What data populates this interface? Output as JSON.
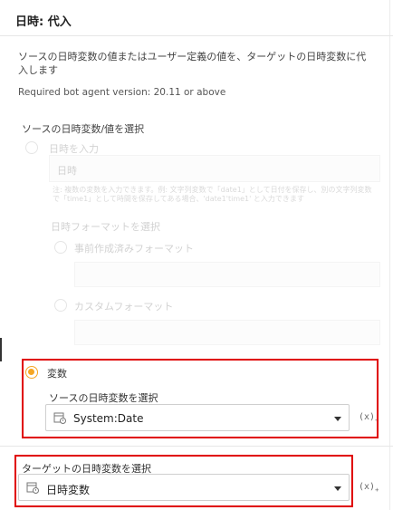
{
  "header": {
    "title": "日時: 代入"
  },
  "description": "ソースの日時変数の値またはユーザー定義の値を、ターゲットの日時変数に代入します",
  "version_text": "Required bot agent version: 20.11 or above",
  "source": {
    "label": "ソースの日時変数/値を選択",
    "option_enter": {
      "label": "日時を入力",
      "placeholder": "日時",
      "hint": "注: 複数の変数を入力できます。例: 文字列変数で「date1」として日付を保存し、別の文字列変数で「time1」として時間を保存してある場合、'date1'time1' と入力できます",
      "format_label": "日時フォーマットを選択",
      "predefined_label": "事前作成済みフォーマット",
      "predefined_value": "",
      "custom_label": "カスタムフォーマット",
      "custom_value": ""
    },
    "option_variable": {
      "label": "変数",
      "select_label": "ソースの日時変数を選択",
      "selected_value": "System:Date"
    }
  },
  "target": {
    "label": "ターゲットの日時変数を選択",
    "selected_value": "日時変数"
  },
  "icons": {
    "variable_icon": "(x)",
    "variable_sub": "+"
  },
  "colors": {
    "accent": "#f5a623",
    "highlight": "#e00000"
  }
}
